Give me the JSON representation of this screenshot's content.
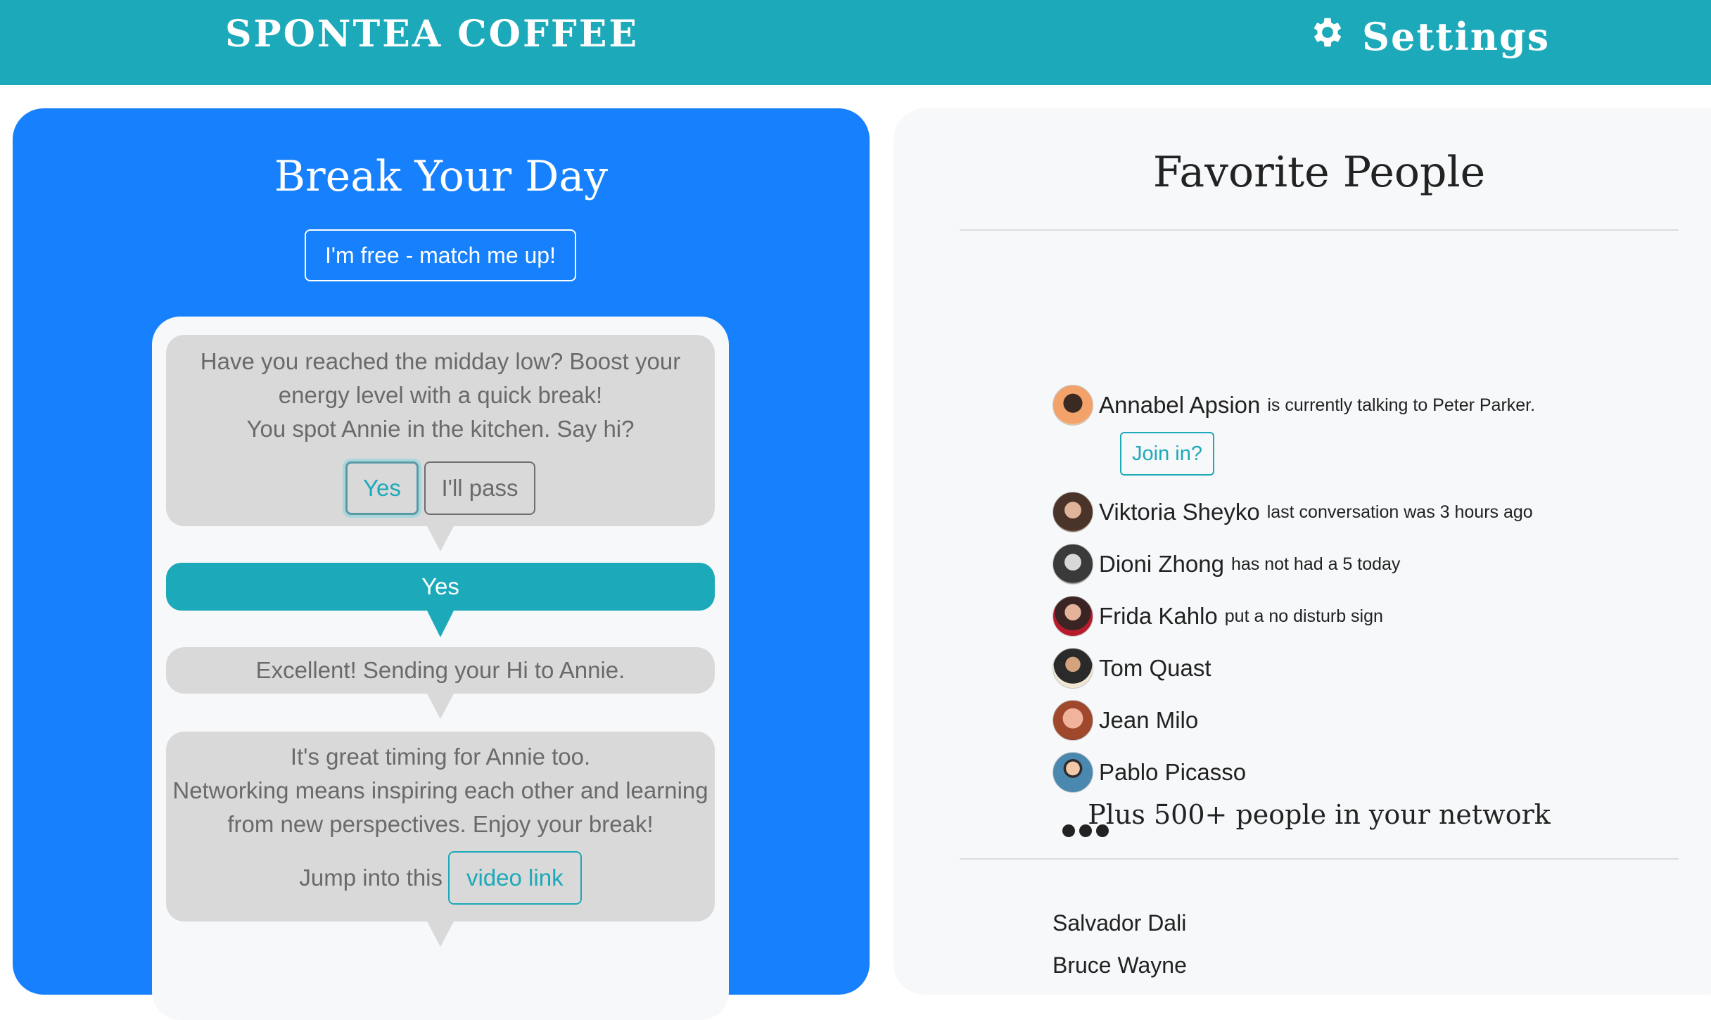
{
  "header": {
    "brand": "SPONTEA COFFEE",
    "settings_label": "Settings",
    "settings_icon": "gear-icon",
    "bg_color": "#1ca9b9"
  },
  "left": {
    "title": "Break Your Day",
    "free_button": "I'm free - match me up!",
    "bg_color": "#1780fc",
    "chat": {
      "prompt_lines": [
        "Have you reached the midday low? Boost your",
        "energy level with a quick break!",
        "You spot Annie in the kitchen. Say hi?"
      ],
      "yes_label": "Yes",
      "pass_label": "I'll pass",
      "reply": "Yes",
      "confirm": "Excellent! Sending your Hi to Annie.",
      "final_lines": [
        "It's great timing for Annie too.",
        "Networking means inspiring each other and learning",
        "from new perspectives. Enjoy your break!"
      ],
      "jump_text": "Jump into this",
      "video_label": "video link"
    }
  },
  "right": {
    "title": "Favorite People",
    "people": [
      {
        "name": "Annabel Apsion",
        "status": "is currently talking to Peter Parker."
      },
      {
        "name": "Viktoria Sheyko",
        "status": "last conversation was 3 hours ago"
      },
      {
        "name": "Dioni Zhong",
        "status": "has not had a 5 today"
      },
      {
        "name": "Frida Kahlo",
        "status": "put a no disturb sign"
      },
      {
        "name": "Tom Quast",
        "status": ""
      },
      {
        "name": "Jean Milo",
        "status": ""
      },
      {
        "name": "Pablo Picasso",
        "status": ""
      }
    ],
    "join_label": "Join in?",
    "more_icon": "more-dots-icon",
    "network_text": "Plus 500+ people in your network",
    "network_people": [
      "Salvador Dali",
      "Bruce Wayne"
    ]
  }
}
